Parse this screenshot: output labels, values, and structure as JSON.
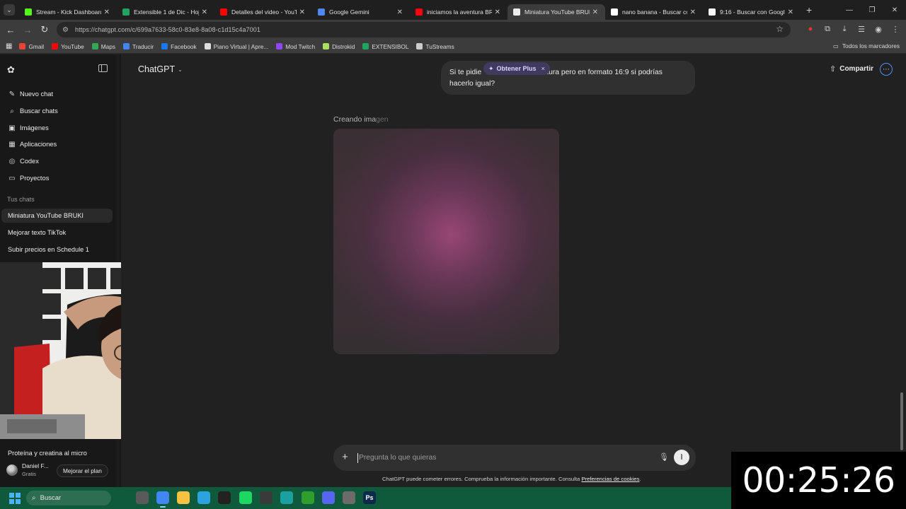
{
  "browser": {
    "tabs": [
      {
        "label": "Stream - Kick Dashboard",
        "color": "#53fc18",
        "active": false
      },
      {
        "label": "Extensible 1 de Dic - Hoja",
        "color": "#1fa463",
        "active": false
      },
      {
        "label": "Detalles del video - YouTu",
        "color": "#ff0000",
        "active": false
      },
      {
        "label": "Google Gemini",
        "color": "#4e86f5",
        "active": false
      },
      {
        "label": "iniciamos la aventura BRU",
        "color": "#ff0000",
        "active": false
      },
      {
        "label": "Miniatura YouTube BRUKI",
        "color": "#ececec",
        "active": true
      },
      {
        "label": "nano banana - Buscar con",
        "color": "#ffffff",
        "active": false
      },
      {
        "label": "9:16 - Buscar con Google",
        "color": "#ffffff",
        "active": false
      }
    ],
    "url": "https://chatgpt.com/c/699a7633-58c0-83e8-8a08-c1d15c4a7001",
    "bookmarks": [
      {
        "label": "Gmail",
        "color": "#ea4335"
      },
      {
        "label": "YouTube",
        "color": "#ff0000"
      },
      {
        "label": "Maps",
        "color": "#34a853"
      },
      {
        "label": "Traducir",
        "color": "#4285f4"
      },
      {
        "label": "Facebook",
        "color": "#1877f2"
      },
      {
        "label": "Piano Virtual | Apre...",
        "color": "#dddddd"
      },
      {
        "label": "Mod Twitch",
        "color": "#9146ff"
      },
      {
        "label": "Distrokid",
        "color": "#a8e05f"
      },
      {
        "label": "EXTENSIBOL",
        "color": "#1fa463"
      },
      {
        "label": "TuStreams",
        "color": "#cccccc"
      }
    ],
    "all_bookmarks": "Todos los marcadores"
  },
  "sidebar": {
    "nav": [
      {
        "label": "Nuevo chat",
        "icon": "edit-icon"
      },
      {
        "label": "Buscar chats",
        "icon": "search-icon"
      },
      {
        "label": "Imágenes",
        "icon": "image-icon"
      },
      {
        "label": "Aplicaciones",
        "icon": "apps-icon"
      },
      {
        "label": "Codex",
        "icon": "codex-icon"
      },
      {
        "label": "Proyectos",
        "icon": "folder-icon"
      }
    ],
    "section_title": "Tus chats",
    "chats": [
      {
        "label": "Miniatura YouTube BRUKI",
        "active": true
      },
      {
        "label": "Mejorar texto TikTok",
        "active": false
      },
      {
        "label": "Subir precios en Schedule 1",
        "active": false
      },
      {
        "label": "Proteína y creatina al micro",
        "active": false
      }
    ],
    "user_name": "Daniel F...",
    "user_plan": "Gratis",
    "upgrade_label": "Mejorar el plan"
  },
  "main": {
    "model_label": "ChatGPT",
    "share_label": "Compartir",
    "user_message": "Si te pidiera una miniatura pero en formato 16:9 si podrías hacerlo igual?",
    "user_message_visible_start": "Si te pidie",
    "user_message_visible_end": "tura pero en formato 16:9 si podrías",
    "user_message_line2": "hacerlo igual?",
    "plus_pill_label": "Obtener Plus",
    "creating_label_a": "Creando ima",
    "creating_label_b": "gen",
    "composer_placeholder": "Pregunta lo que quieras",
    "disclaimer_text": "ChatGPT puede cometer errores. Comprueba la información importante. Consulta ",
    "disclaimer_link": "Preferencias de cookies",
    "disclaimer_end": "."
  },
  "timer": "00:25:26",
  "taskbar": {
    "search_label": "Buscar",
    "apps": [
      {
        "name": "task-view",
        "color": "#5a5a5a",
        "glyph": ""
      },
      {
        "name": "chrome",
        "color": "#4285f4",
        "glyph": "",
        "active": true
      },
      {
        "name": "file-explorer",
        "color": "#f5c242",
        "glyph": ""
      },
      {
        "name": "telegram",
        "color": "#2aa3df",
        "glyph": ""
      },
      {
        "name": "capcut",
        "color": "#222222",
        "glyph": ""
      },
      {
        "name": "spotify",
        "color": "#1ed760",
        "glyph": ""
      },
      {
        "name": "obs",
        "color": "#3a3a3a",
        "glyph": ""
      },
      {
        "name": "edge",
        "color": "#1aa0a0",
        "glyph": ""
      },
      {
        "name": "xbox",
        "color": "#2f9e2f",
        "glyph": ""
      },
      {
        "name": "discord",
        "color": "#5865f2",
        "glyph": ""
      },
      {
        "name": "snipping",
        "color": "#6b6b6b",
        "glyph": ""
      },
      {
        "name": "photoshop",
        "color": "#0d2a4d",
        "glyph": "Ps"
      }
    ]
  }
}
